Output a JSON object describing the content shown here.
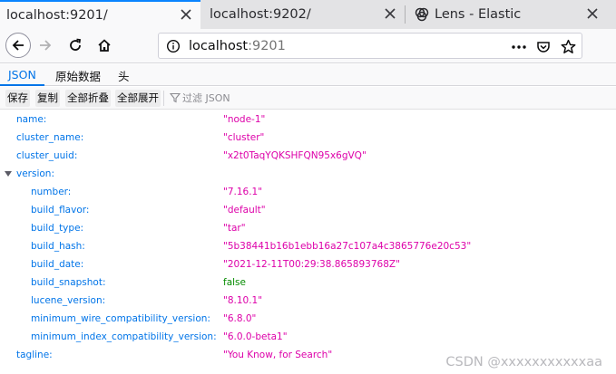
{
  "browser": {
    "tabs": [
      {
        "label": "localhost:9201/",
        "active": true
      },
      {
        "label": "localhost:9202/",
        "active": false
      },
      {
        "label": "Lens - Elastic",
        "active": false
      }
    ],
    "url": {
      "host": "localhost",
      "port": ":9201"
    }
  },
  "viewer": {
    "tabs": [
      "JSON",
      "原始数据",
      "头"
    ],
    "selected_tab": "JSON",
    "toolbar": {
      "save": "保存",
      "copy": "复制",
      "collapse_all": "全部折叠",
      "expand_all": "全部展开",
      "filter_placeholder": "过滤 JSON"
    }
  },
  "json": {
    "name": {
      "key": "name:",
      "value": "\"node-1\""
    },
    "cluster_name": {
      "key": "cluster_name:",
      "value": "\"cluster\""
    },
    "cluster_uuid": {
      "key": "cluster_uuid:",
      "value": "\"x2t0TaqYQKSHFQN95x6gVQ\""
    },
    "version": {
      "key": "version:",
      "number": {
        "key": "number:",
        "value": "\"7.16.1\""
      },
      "build_flavor": {
        "key": "build_flavor:",
        "value": "\"default\""
      },
      "build_type": {
        "key": "build_type:",
        "value": "\"tar\""
      },
      "build_hash": {
        "key": "build_hash:",
        "value": "\"5b38441b16b1ebb16a27c107a4c3865776e20c53\""
      },
      "build_date": {
        "key": "build_date:",
        "value": "\"2021-12-11T00:29:38.865893768Z\""
      },
      "build_snapshot": {
        "key": "build_snapshot:",
        "value": "false"
      },
      "lucene_version": {
        "key": "lucene_version:",
        "value": "\"8.10.1\""
      },
      "minimum_wire_compatibility_version": {
        "key": "minimum_wire_compatibility_version:",
        "value": "\"6.8.0\""
      },
      "minimum_index_compatibility_version": {
        "key": "minimum_index_compatibility_version:",
        "value": "\"6.0.0-beta1\""
      }
    },
    "tagline": {
      "key": "tagline:",
      "value": "\"You Know, for Search\""
    }
  },
  "watermark": "CSDN @xxxxxxxxxxxaa",
  "colors": {
    "accent": "#0074e8",
    "string": "#dd00a9",
    "boolean": "#058b00",
    "key": "#0074e8"
  },
  "icons": [
    "back-icon",
    "forward-icon",
    "reload-icon",
    "home-icon",
    "info-icon",
    "more-icon",
    "pocket-icon",
    "bookmark-star-icon",
    "close-icon",
    "filter-icon",
    "collapse-arrow-icon",
    "lens-tab-icon"
  ]
}
